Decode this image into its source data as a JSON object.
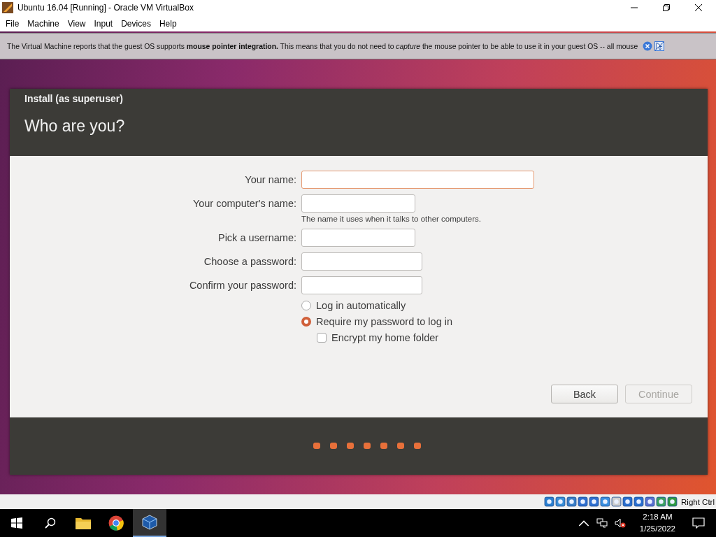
{
  "window": {
    "title": "Ubuntu 16.04 [Running] - Oracle VM VirtualBox"
  },
  "menu": [
    "File",
    "Machine",
    "View",
    "Input",
    "Devices",
    "Help"
  ],
  "notification": {
    "text": "The Virtual Machine reports that the guest OS supports **mouse pointer integration.** This means that you do not need to *capture* the mouse pointer to be able to use it in your guest OS -- all mouse"
  },
  "installer": {
    "window_title": "Install (as superuser)",
    "heading": "Who are you?",
    "fields": [
      {
        "label": "Your name:",
        "focused": true
      },
      {
        "label": "Your computer's name:",
        "focused": false,
        "hint": "The name it uses when it talks to other computers."
      },
      {
        "label": "Pick a username:",
        "focused": false
      },
      {
        "label": "Choose a password:",
        "focused": false
      },
      {
        "label": "Confirm your password:",
        "focused": false
      }
    ],
    "login_options": [
      {
        "label": "Log in automatically",
        "selected": false
      },
      {
        "label": "Require my password to log in",
        "selected": true
      }
    ],
    "encrypt": {
      "label": "Encrypt my home folder",
      "checked": false
    },
    "buttons": [
      {
        "label": "Back",
        "disabled": false
      },
      {
        "label": "Continue",
        "disabled": true
      }
    ]
  },
  "status_bar": {
    "host_key": "Right Ctrl"
  },
  "taskbar": {
    "time": "2:18 AM",
    "date": "1/25/2022"
  }
}
